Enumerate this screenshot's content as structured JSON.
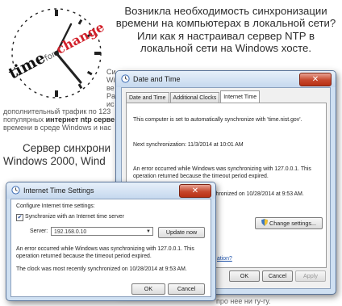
{
  "article": {
    "headline": "Возникла необходимость синхронизации времени на компьютерах в локальной сети? Или как я настраивал сервер NTP в локальной сети на Windows хосте.",
    "logo_text": "time for change",
    "para_line1": "Си",
    "para_line2": "Wi",
    "para_line3": "ве",
    "para_line4": "Pa",
    "para_line5": "ис",
    "para_line6": "дополнительный трафик по 123",
    "para_line7_pre": "популярных ",
    "para_line7_bold": "интернет ntp серве",
    "para_line8": "времени в среде Windows и нас",
    "subhead_line1": "Сервер синхрони",
    "subhead_line2": "Windows 2000, Wind",
    "bottom_fragment": "про нее ни гу-гу."
  },
  "date_time_dialog": {
    "title": "Date and Time",
    "tabs": [
      "Date and Time",
      "Additional Clocks",
      "Internet Time"
    ],
    "active_tab": "Internet Time",
    "auto_sync_text": "This computer is set to automatically synchronize with 'time.nist.gov'.",
    "next_sync_text": "Next synchronization: 11/3/2014 at 10:01 AM",
    "error_text": "An error occurred while Windows was synchronizing with 127.0.0.1.  This operation returned because the timeout period expired.",
    "last_sync_text": "The clock was most recently synchronized on 10/28/2014 at 9:53 AM.",
    "change_settings_label": "Change settings...",
    "link_fragment": "ation?",
    "ok_label": "OK",
    "cancel_label": "Cancel",
    "apply_label": "Apply"
  },
  "internet_time_settings": {
    "title": "Internet Time Settings",
    "heading": "Configure Internet time settings:",
    "sync_checkbox_label": "Synchronize with an Internet time server",
    "sync_checked": true,
    "server_label": "Server:",
    "server_value": "192.168.0.10",
    "update_now_label": "Update now",
    "error_text": "An error occurred while Windows was synchronizing with 127.0.0.1.  This operation returned because the timeout period expired.",
    "last_sync_text": "The clock was most recently synchronized on 10/28/2014 at 9:53 AM.",
    "ok_label": "OK",
    "cancel_label": "Cancel"
  },
  "colors": {
    "window_frame": "#cfe0f2",
    "close_button": "#c6472d",
    "logo_red": "#d2202a",
    "link_blue": "#1a4fa8"
  },
  "icons": [
    "clock-icon",
    "close-icon",
    "checkmark-icon",
    "shield-icon",
    "dropdown-arrow-icon"
  ]
}
